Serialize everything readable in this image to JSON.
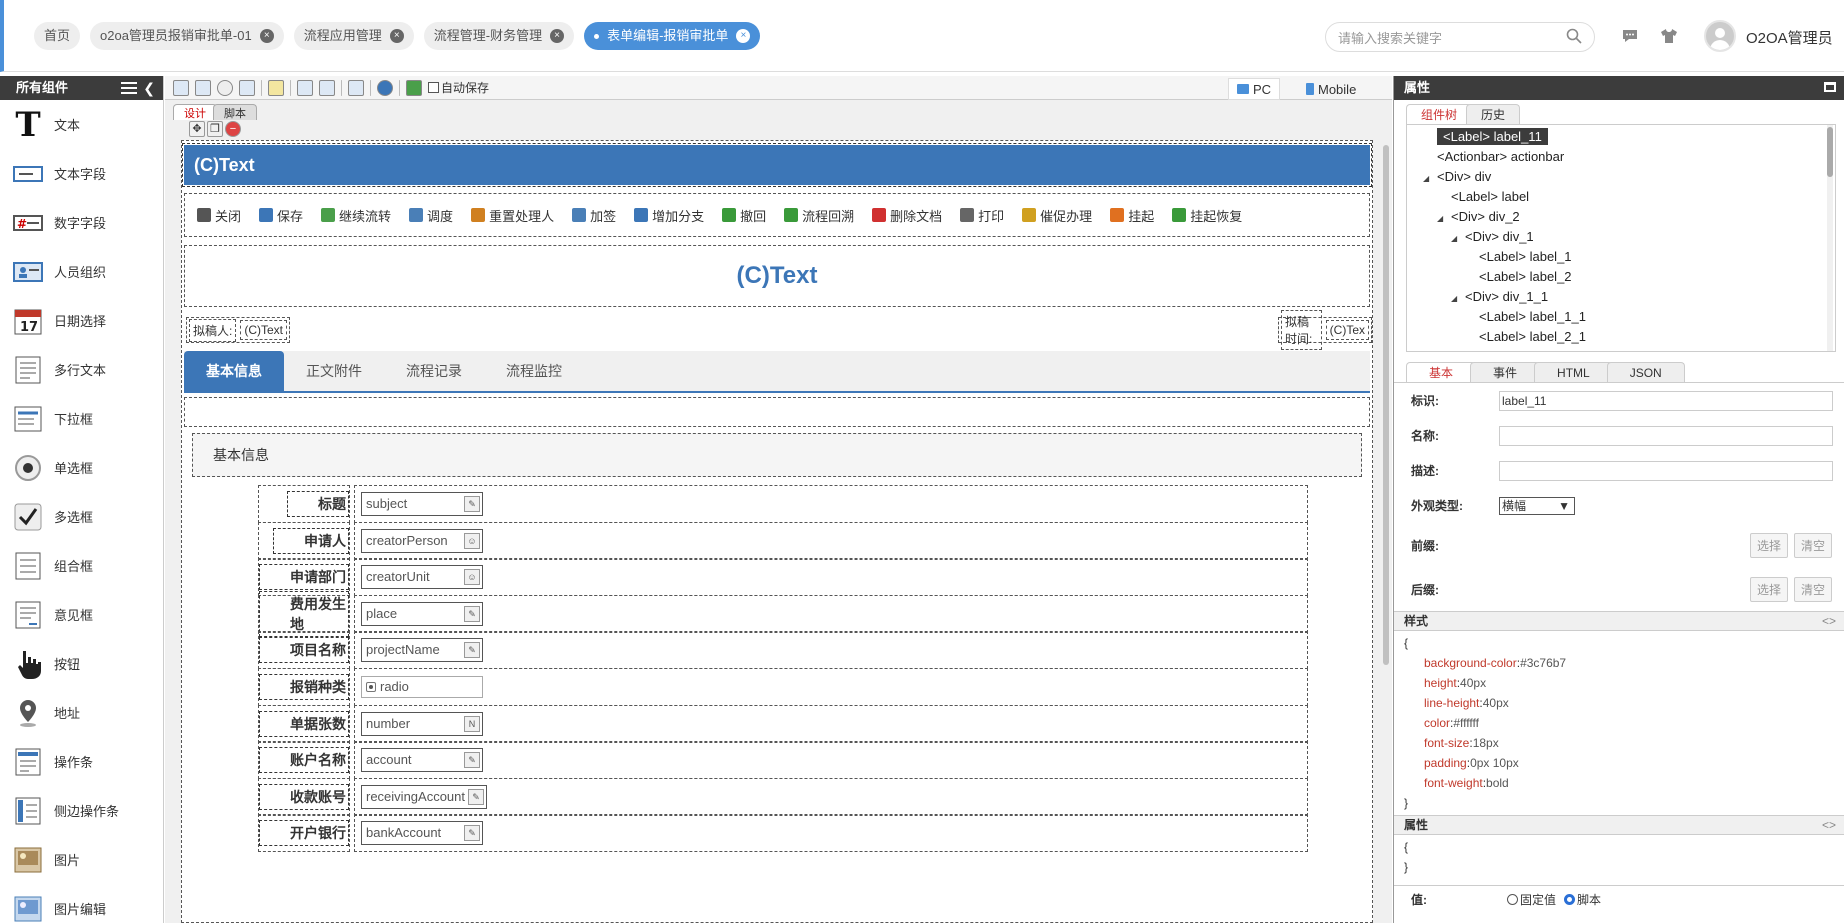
{
  "topbar": {
    "tabs": [
      {
        "label": "首页",
        "closable": false
      },
      {
        "label": "o2oa管理员报销审批单-01",
        "closable": true
      },
      {
        "label": "流程应用管理",
        "closable": true
      },
      {
        "label": "流程管理-财务管理",
        "closable": true
      },
      {
        "label": "表单编辑-报销审批单",
        "closable": true,
        "active": true
      }
    ],
    "search_placeholder": "请输入搜索关键字",
    "username": "O2OA管理员",
    "accent": "#4a90d9"
  },
  "left": {
    "title": "所有组件",
    "items": [
      {
        "label": "文本",
        "icon": "text-T-icon"
      },
      {
        "label": "文本字段",
        "icon": "textfield-icon"
      },
      {
        "label": "数字字段",
        "icon": "number-field-icon"
      },
      {
        "label": "人员组织",
        "icon": "person-org-icon"
      },
      {
        "label": "日期选择",
        "icon": "calendar-icon"
      },
      {
        "label": "多行文本",
        "icon": "textarea-icon"
      },
      {
        "label": "下拉框",
        "icon": "select-icon"
      },
      {
        "label": "单选框",
        "icon": "radio-icon"
      },
      {
        "label": "多选框",
        "icon": "checkbox-icon"
      },
      {
        "label": "组合框",
        "icon": "combox-icon"
      },
      {
        "label": "意见框",
        "icon": "opinion-icon"
      },
      {
        "label": "按钮",
        "icon": "hand-pointer-icon"
      },
      {
        "label": "地址",
        "icon": "location-pin-icon"
      },
      {
        "label": "操作条",
        "icon": "actionbar-icon"
      },
      {
        "label": "侧边操作条",
        "icon": "sidebar-actionbar-icon"
      },
      {
        "label": "图片",
        "icon": "image-icon"
      },
      {
        "label": "图片编辑",
        "icon": "image-edit-icon"
      }
    ]
  },
  "canvas": {
    "auto_save": "自动保存",
    "pc": "PC",
    "mobile": "Mobile",
    "design_tabs": [
      "设计",
      "脚本"
    ],
    "header_text": "(C)Text",
    "actions": [
      {
        "label": "关闭",
        "color": "#555"
      },
      {
        "label": "保存",
        "color": "#3c76b7"
      },
      {
        "label": "继续流转",
        "color": "#4a9f4a"
      },
      {
        "label": "调度",
        "color": "#4a7fb7"
      },
      {
        "label": "重置处理人",
        "color": "#d08020"
      },
      {
        "label": "加签",
        "color": "#4a7fb7"
      },
      {
        "label": "增加分支",
        "color": "#3c76b7"
      },
      {
        "label": "撤回",
        "color": "#3a9a3a"
      },
      {
        "label": "流程回溯",
        "color": "#3a9a3a"
      },
      {
        "label": "删除文档",
        "color": "#d03030"
      },
      {
        "label": "打印",
        "color": "#666"
      },
      {
        "label": "催促办理",
        "color": "#d0a020"
      },
      {
        "label": "挂起",
        "color": "#e07020"
      },
      {
        "label": "挂起恢复",
        "color": "#3a9a3a"
      }
    ],
    "big_title": "(C)Text",
    "meta_left": {
      "label": "拟稿人:",
      "value": "(C)Text"
    },
    "meta_right": {
      "label": "拟稿时间:",
      "value": "(C)Tex"
    },
    "form_tabs": [
      "基本信息",
      "正文附件",
      "流程记录",
      "流程监控"
    ],
    "section_title": "基本信息",
    "fields": [
      {
        "label": "标题",
        "value": "subject",
        "type": "text"
      },
      {
        "label": "申请人",
        "value": "creatorPerson",
        "type": "person"
      },
      {
        "label": "申请部门",
        "value": "creatorUnit",
        "type": "person"
      },
      {
        "label": "费用发生地",
        "value": "place",
        "type": "text"
      },
      {
        "label": "项目名称",
        "value": "projectName",
        "type": "text"
      },
      {
        "label": "报销种类",
        "value": "radio",
        "type": "radio"
      },
      {
        "label": "单据张数",
        "value": "number",
        "type": "number"
      },
      {
        "label": "账户名称",
        "value": "account",
        "type": "text"
      },
      {
        "label": "收款账号",
        "value": "receivingAccount",
        "type": "text"
      },
      {
        "label": "开户银行",
        "value": "bankAccount",
        "type": "text"
      }
    ]
  },
  "right": {
    "title": "属性",
    "tree_tabs": [
      "组件树",
      "历史"
    ],
    "tree": [
      {
        "text": "<Label> label_11",
        "indent": 0,
        "selected": true
      },
      {
        "text": "<Actionbar> actionbar",
        "indent": 0
      },
      {
        "text": "<Div> div",
        "indent": 0,
        "expand": true
      },
      {
        "text": "<Label> label",
        "indent": 1
      },
      {
        "text": "<Div> div_2",
        "indent": 1,
        "expand": true
      },
      {
        "text": "<Div> div_1",
        "indent": 2,
        "expand": true
      },
      {
        "text": "<Label> label_1",
        "indent": 3
      },
      {
        "text": "<Label> label_2",
        "indent": 3
      },
      {
        "text": "<Div> div_1_1",
        "indent": 2,
        "expand": true
      },
      {
        "text": "<Label> label_1_1",
        "indent": 3
      },
      {
        "text": "<Label> label_2_1",
        "indent": 3
      }
    ],
    "prop_tabs": [
      "基本",
      "事件",
      "HTML",
      "JSON"
    ],
    "id_label": "标识:",
    "id_value": "label_11",
    "name_label": "名称:",
    "desc_label": "描述:",
    "appearance_label": "外观类型:",
    "appearance_value": "横幅",
    "prefix_label": "前缀:",
    "suffix_label": "后缀:",
    "select_btn": "选择",
    "clear_btn": "清空",
    "style_title": "样式",
    "style_props": [
      {
        "k": "background-color",
        "v": "#3c76b7"
      },
      {
        "k": "height",
        "v": "40px"
      },
      {
        "k": "line-height",
        "v": "40px"
      },
      {
        "k": "color",
        "v": "#ffffff"
      },
      {
        "k": "font-size",
        "v": "18px"
      },
      {
        "k": "padding",
        "v": "0px 10px"
      },
      {
        "k": "font-weight",
        "v": "bold"
      }
    ],
    "attr_title": "属性",
    "toggle": "<>",
    "value_label": "值:",
    "value_opt1": "固定值",
    "value_opt2": "脚本"
  }
}
